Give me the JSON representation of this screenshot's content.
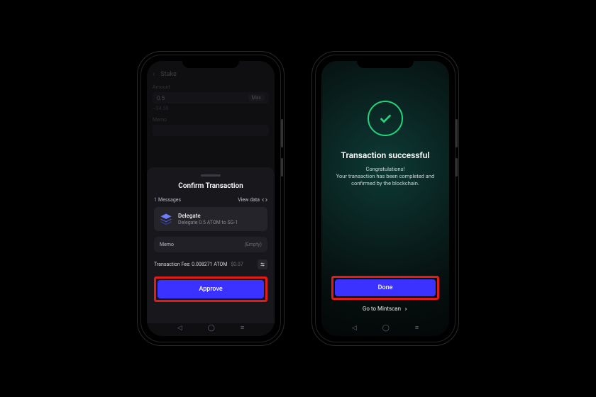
{
  "colors": {
    "primary": "#3b32ff",
    "highlight_border": "#e31b1b",
    "success": "#22d47a"
  },
  "phoneA": {
    "background": {
      "header_title": "Stake",
      "amount_label": "Amount",
      "amount_value": "0.5",
      "max_label": "Max",
      "sub_value": "~$4.58",
      "memo_label": "Memo"
    },
    "sheet": {
      "title": "Confirm Transaction",
      "messages_count": "1",
      "messages_label": "Messages",
      "view_data_label": "View data",
      "delegate": {
        "title": "Delegate",
        "subtitle": "Delegate 0.5 ATOM to SG-1"
      },
      "memo_label": "Memo",
      "memo_value": "(Empty)",
      "fee_label": "Transaction Fee:",
      "fee_amount": "0.008271 ATOM",
      "fee_usd": "$0.07",
      "approve_label": "Approve"
    }
  },
  "phoneB": {
    "title": "Transaction successful",
    "congrats": "Congratulations!",
    "body": "Your transaction has been completed and confirmed by the blockchain.",
    "done_label": "Done",
    "link_label": "Go to Mintscan"
  }
}
